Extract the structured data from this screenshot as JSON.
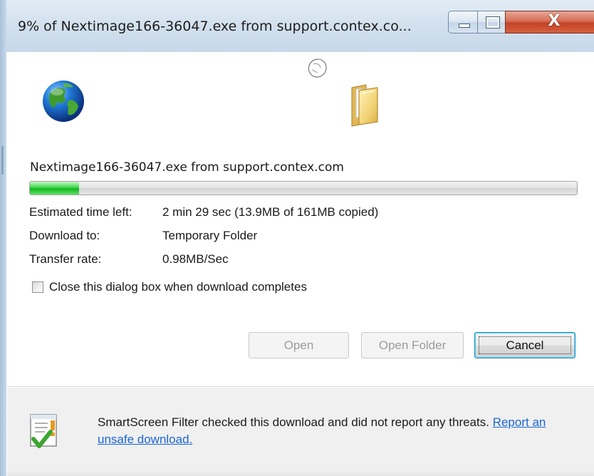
{
  "window": {
    "title": "9% of Nextimage166-36047.exe from support.contex.co...",
    "caption_close_glyph": "X"
  },
  "download": {
    "filename_line": "Nextimage166-36047.exe from support.contex.com",
    "progress_fraction": 0.09,
    "rows": [
      {
        "label": "Estimated time left:",
        "value": "2 min 29 sec (13.9MB of 161MB copied)"
      },
      {
        "label": "Download to:",
        "value": "Temporary Folder"
      },
      {
        "label": "Transfer rate:",
        "value": "0.98MB/Sec"
      }
    ],
    "close_checkbox": {
      "label": "Close this dialog box when download completes",
      "checked": false
    }
  },
  "buttons": {
    "open": "Open",
    "open_folder": "Open Folder",
    "cancel": "Cancel"
  },
  "footer": {
    "message": "SmartScreen Filter checked this download and did not report any threats.",
    "link": "Report an unsafe download."
  },
  "icons": {
    "globe": "globe-icon",
    "flying_page": "flying-page-icon",
    "folder": "folder-icon",
    "smartscreen": "smartscreen-shield-icon"
  },
  "colors": {
    "progress_green": "#11b521",
    "link_blue": "#1a65d6",
    "close_red": "#c3422a"
  }
}
